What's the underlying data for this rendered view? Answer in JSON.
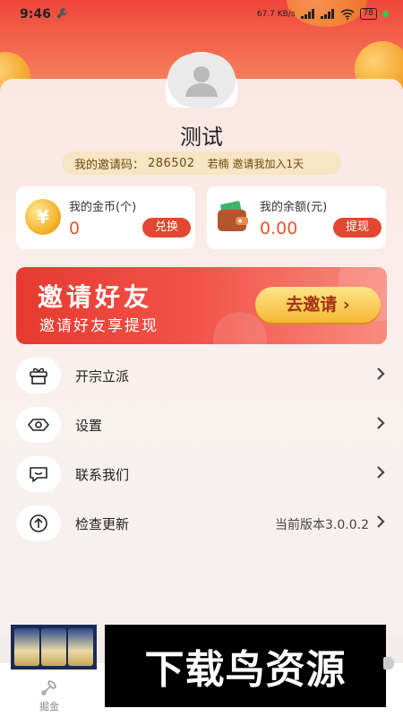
{
  "status_bar": {
    "time": "9:46",
    "net_speed": "67.7 KB/s",
    "battery": "78"
  },
  "profile": {
    "name": "测试",
    "invite_label": "我的邀请码：",
    "invite_code": "286502",
    "invited_by": "若楠 邀请我加入1天"
  },
  "stats": {
    "coins": {
      "title": "我的金币(个)",
      "value": "0",
      "button": "兑换",
      "icon": "coin-icon"
    },
    "balance": {
      "title": "我的余额(元)",
      "value": "0.00",
      "button": "提现",
      "icon": "wallet-icon"
    }
  },
  "banner": {
    "title": "邀请好友",
    "subtitle": "邀请好友享提现",
    "button": "去邀请 ›"
  },
  "menu": [
    {
      "label": "开宗立派",
      "icon": "gift-icon",
      "extra": ""
    },
    {
      "label": "设置",
      "icon": "eye-icon",
      "extra": ""
    },
    {
      "label": "联系我们",
      "icon": "chat-icon",
      "extra": ""
    },
    {
      "label": "检查更新",
      "icon": "upload-icon",
      "extra": "当前版本3.0.0.2"
    }
  ],
  "tabbar": {
    "tab_label": "掘金"
  },
  "ad": {
    "text": "下载鸟资源"
  },
  "colors": {
    "accent": "#e24730",
    "value_text": "#e8542f",
    "invite_bg": "#f7e5c3"
  }
}
